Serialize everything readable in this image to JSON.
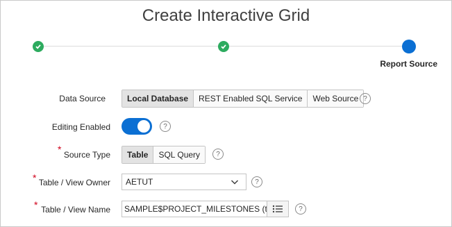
{
  "dialog": {
    "title": "Create Interactive Grid"
  },
  "wizard": {
    "current_step_label": "Report Source"
  },
  "form": {
    "data_source": {
      "label": "Data Source",
      "options": [
        "Local Database",
        "REST Enabled SQL Service",
        "Web Source"
      ],
      "selected": "Local Database",
      "help": "?"
    },
    "editing_enabled": {
      "label": "Editing Enabled",
      "value": true,
      "help": "?"
    },
    "source_type": {
      "label": "Source Type",
      "required_mark": "*",
      "options": [
        "Table",
        "SQL Query"
      ],
      "selected": "Table",
      "help": "?"
    },
    "table_owner": {
      "label": "Table / View Owner",
      "required_mark": "*",
      "value": "AETUT",
      "help": "?"
    },
    "table_name": {
      "label": "Table / View Name",
      "required_mark": "*",
      "value": "SAMPLE$PROJECT_MILESTONES (table)",
      "help": "?"
    }
  },
  "colors": {
    "accent": "#0b6fd3",
    "step_done": "#2dab5f",
    "required": "#d0021b"
  },
  "icons": [
    "check-icon",
    "chevron-down-icon",
    "list-icon",
    "help-icon"
  ]
}
